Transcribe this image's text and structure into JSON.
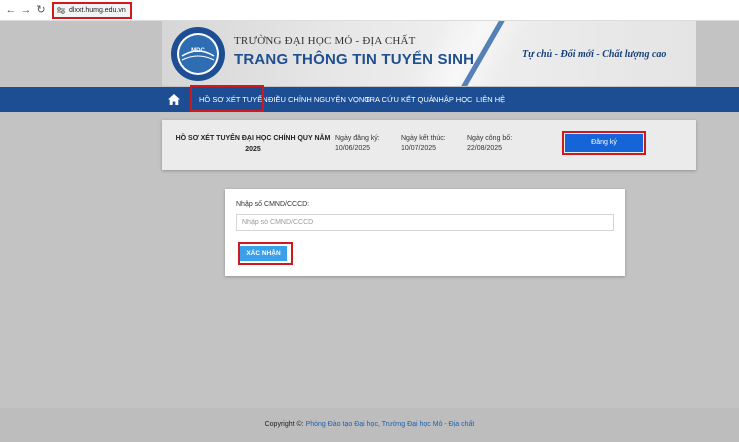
{
  "browser": {
    "url": "dlxxt.humg.edu.vn"
  },
  "header": {
    "university": "TRƯỜNG ĐẠI HỌC MỎ - ĐỊA CHẤT",
    "title": "TRANG THÔNG TIN TUYỂN SINH",
    "slogan": "Tự chủ - Đổi mới - Chất lượng cao",
    "logo_text": "MDC"
  },
  "nav": {
    "items": [
      {
        "label": "HỒ SƠ XÉT TUYỂN"
      },
      {
        "label": "ĐIỀU CHỈNH NGUYỆN VỌNG"
      },
      {
        "label": "TRA CỨU KẾT QUẢ"
      },
      {
        "label": "NHẬP HỌC"
      },
      {
        "label": "LIÊN HỆ"
      }
    ]
  },
  "admission": {
    "title": "HỒ SƠ XÉT TUYỂN ĐẠI HỌC CHÍNH QUY NĂM 2025",
    "register_date_label": "Ngày đăng ký:",
    "register_date": "10/06/2025",
    "end_date_label": "Ngày kết thúc:",
    "end_date": "10/07/2025",
    "announce_date_label": "Ngày công bố:",
    "announce_date": "22/08/2025",
    "register_button": "Đăng ký"
  },
  "id_form": {
    "label": "Nhập số CMND/CCCD:",
    "placeholder": "Nhập số CMND/CCCD",
    "value": "",
    "confirm_button": "XÁC NHẬN"
  },
  "footer": {
    "prefix": "Copyright ©: ",
    "link": "Phòng Đào tạo Đại học, Trường Đại học Mỏ - Địa chất"
  },
  "colors": {
    "nav_bg": "#1d4e93",
    "primary_button": "#1565d8",
    "confirm_button": "#3aa0ea",
    "highlight_outline": "#d0191f"
  }
}
